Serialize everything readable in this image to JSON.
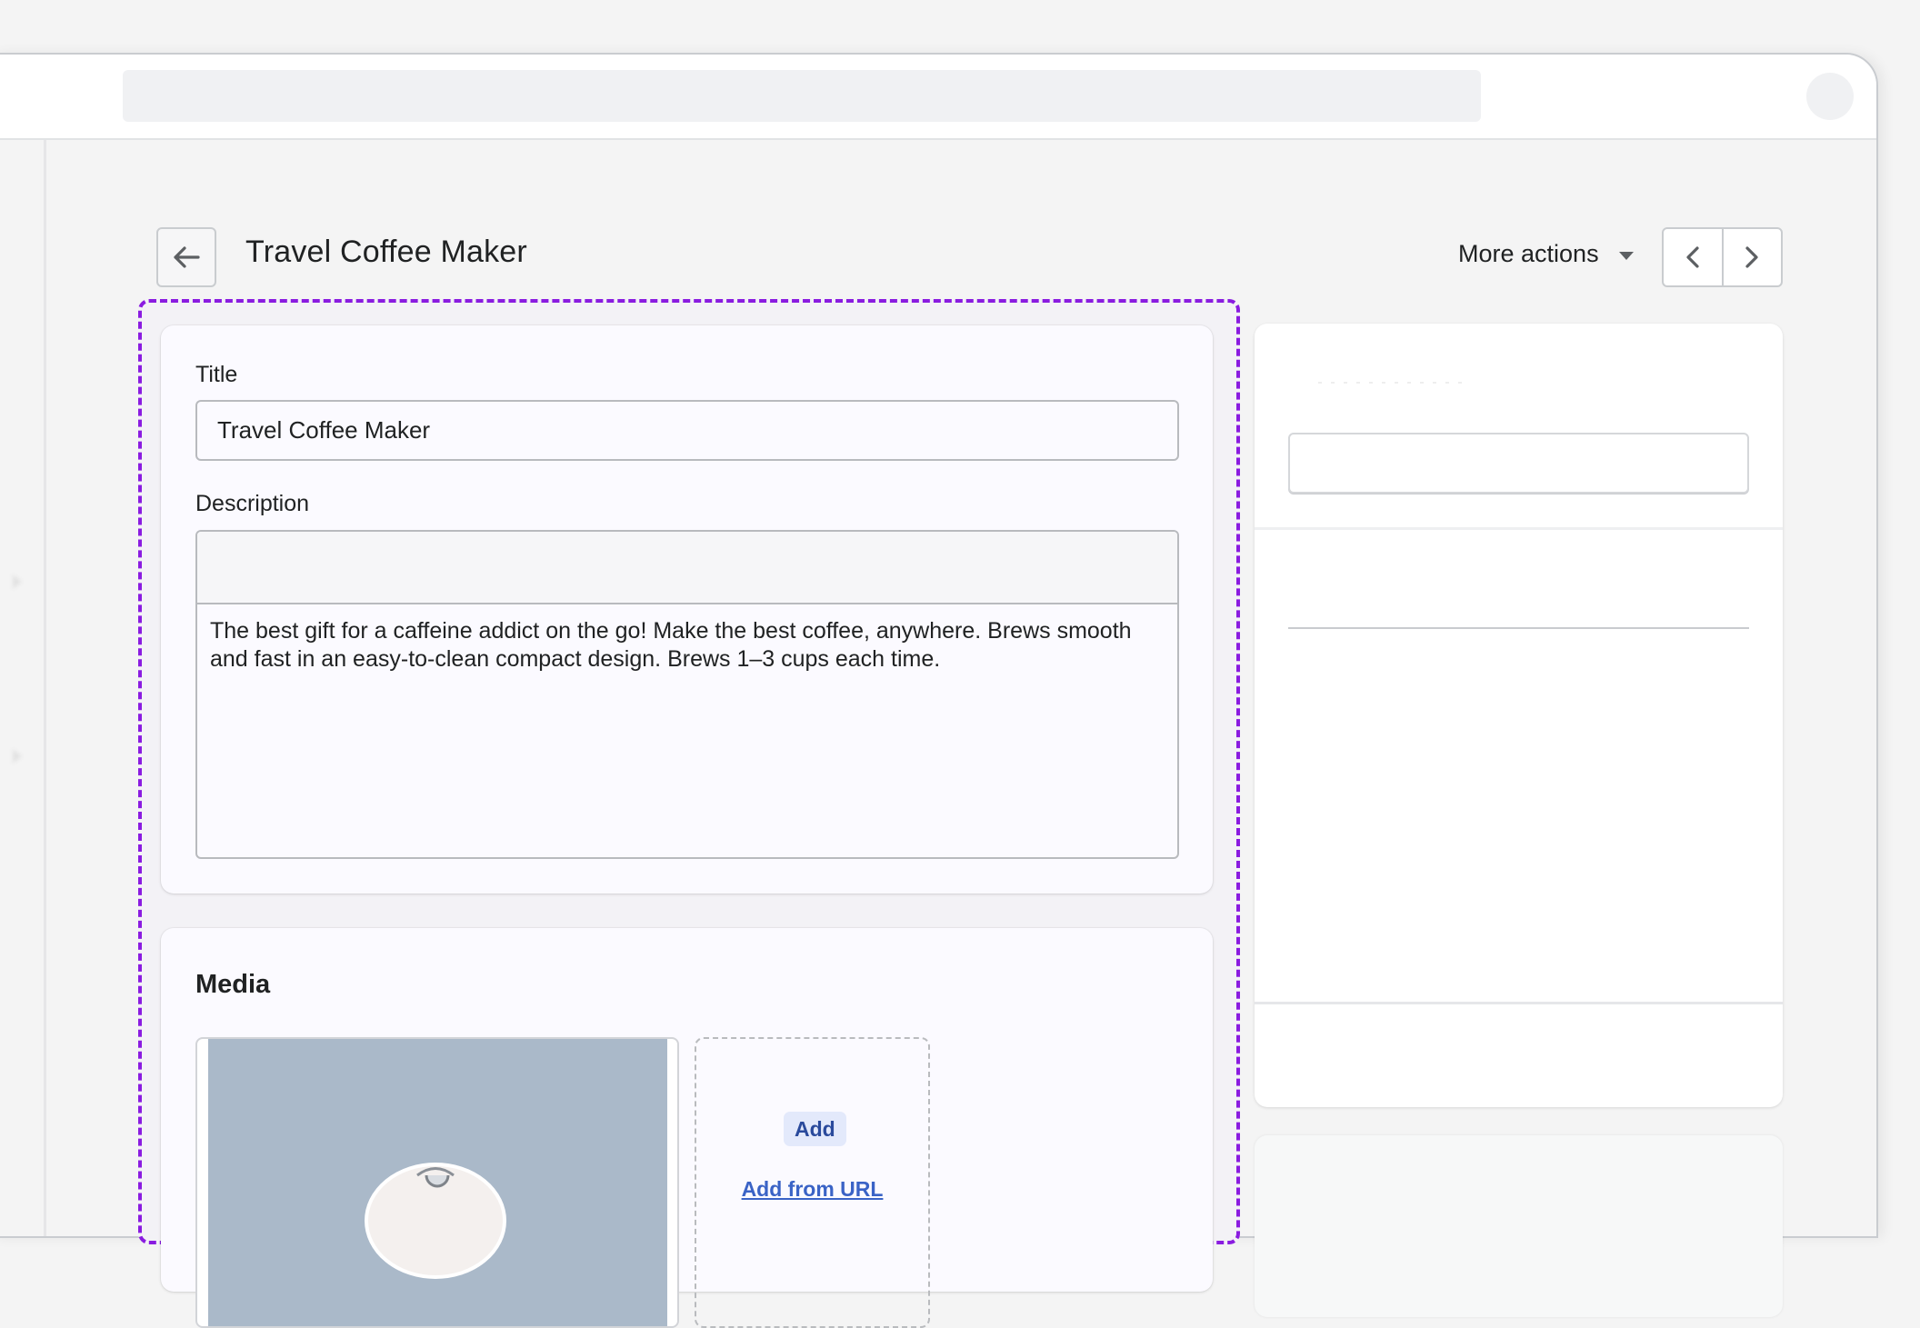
{
  "topbar": {
    "search_placeholder": ""
  },
  "header": {
    "back_label": "Back",
    "title": "Travel Coffee Maker",
    "more_actions": "More actions",
    "prev_label": "Previous product",
    "next_label": "Next product"
  },
  "product_form": {
    "title_label": "Title",
    "title_value": "Travel Coffee Maker",
    "description_label": "Description",
    "description_value": "The best gift for a caffeine addict on the go! Make the best coffee, anywhere. Brews smooth and fast in an easy-to-clean compact design. Brews 1–3 cups each time."
  },
  "media": {
    "heading": "Media",
    "image_alt": "Travel coffee maker product photo",
    "add_button": "Add",
    "add_from_url": "Add from URL"
  },
  "colors": {
    "focus_outline": "#8a1ce0",
    "link": "#3a63c6",
    "add_button_bg": "#e3e9fb",
    "photo_background": "#aab9c9"
  }
}
